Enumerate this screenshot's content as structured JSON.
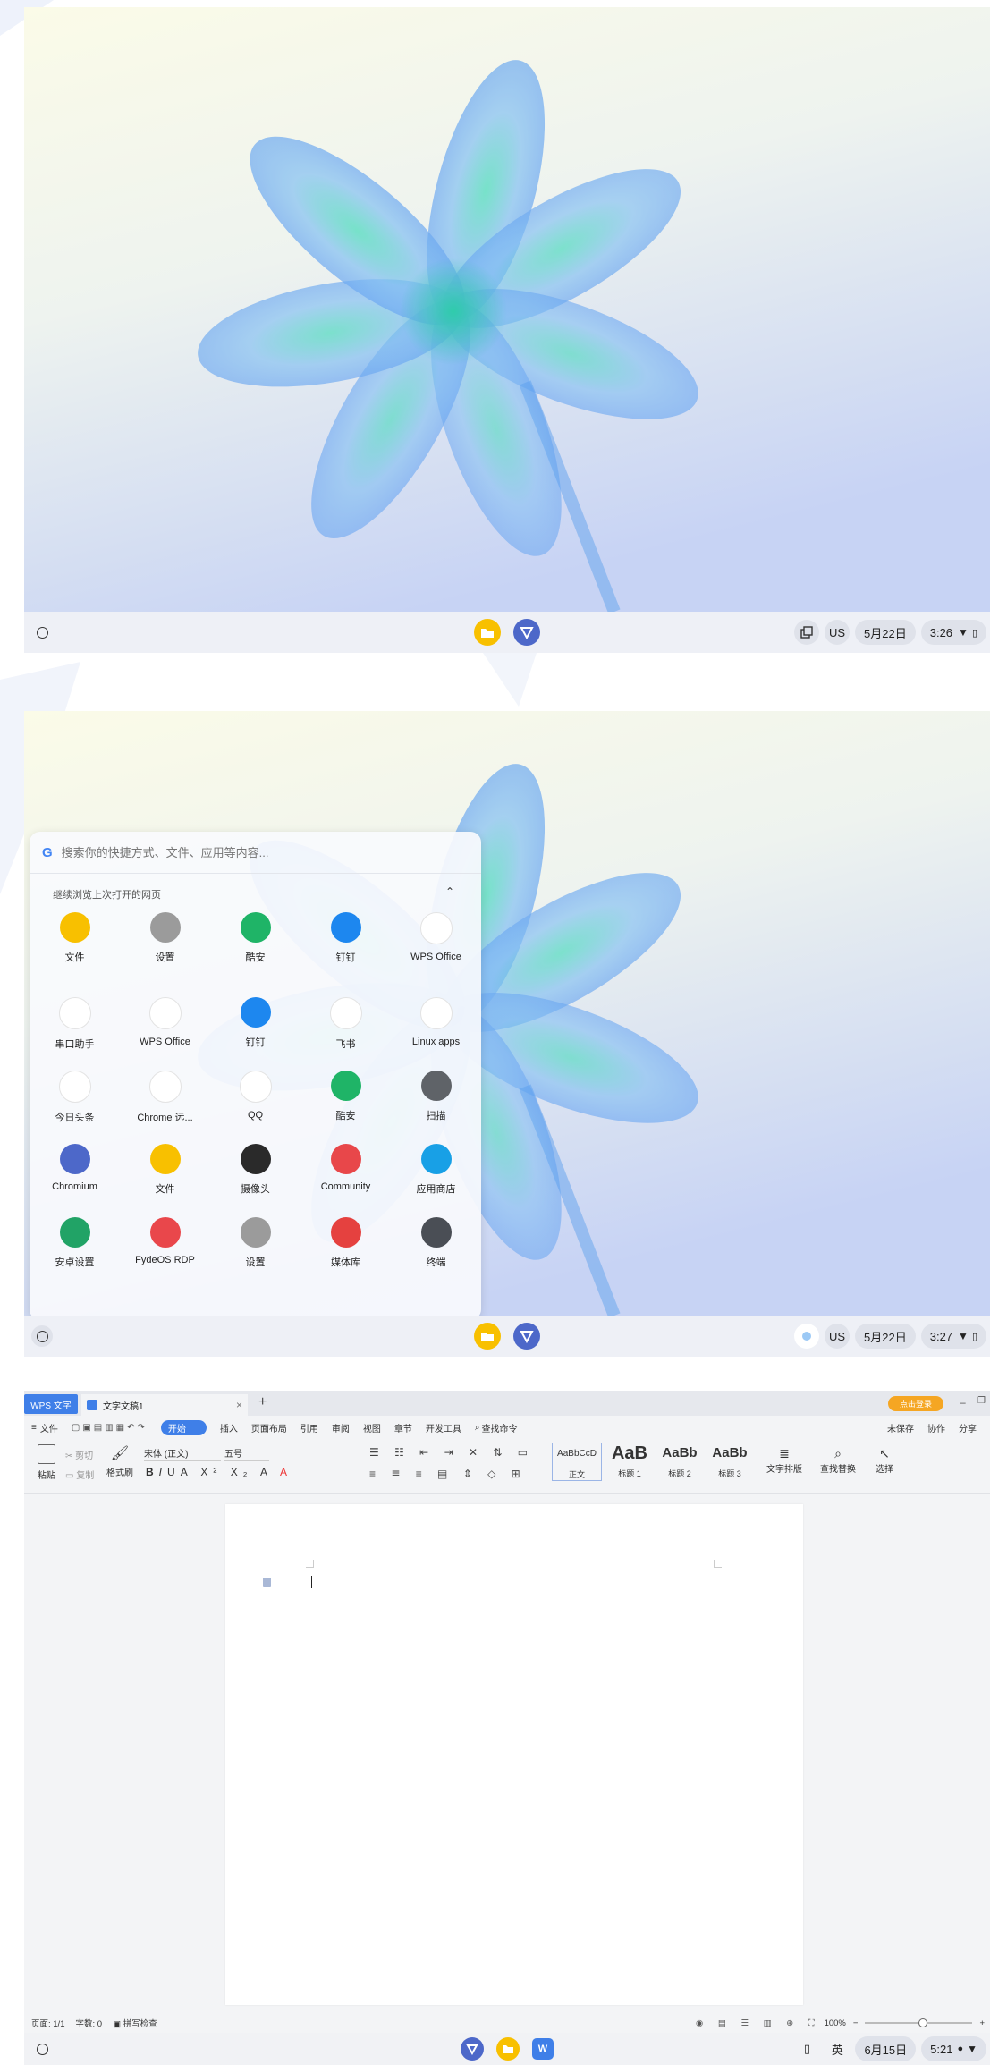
{
  "screens": [
    {
      "shelf": {
        "tray": {
          "ime": "US",
          "date": "5月22日",
          "time": "3:26"
        }
      }
    },
    {
      "launcher": {
        "search_placeholder": "搜索你的快捷方式、文件、应用等内容...",
        "continue_label": "继续浏览上次打开的网页",
        "recent": [
          {
            "label": "文件",
            "icon": "files-icon",
            "color": "#f8c000"
          },
          {
            "label": "设置",
            "icon": "settings-icon",
            "color": "#9b9b9b"
          },
          {
            "label": "酷安",
            "icon": "coolapk-icon",
            "color": "#1fb467"
          },
          {
            "label": "钉钉",
            "icon": "dingtalk-icon",
            "color": "#1d87ef"
          },
          {
            "label": "WPS Office",
            "icon": "wps-office-icon",
            "color": "#ffffff"
          }
        ],
        "apps": [
          {
            "label": "串口助手",
            "icon": "serial-assistant-icon",
            "color": "#ffffff"
          },
          {
            "label": "WPS Office",
            "icon": "wps-office-icon",
            "color": "#ffffff"
          },
          {
            "label": "钉钉",
            "icon": "dingtalk-icon",
            "color": "#1d87ef"
          },
          {
            "label": "飞书",
            "icon": "feishu-icon",
            "color": "#ffffff"
          },
          {
            "label": "Linux apps",
            "icon": "linux-apps-icon",
            "color": "#ffffff"
          },
          {
            "label": "今日头条",
            "icon": "toutiao-icon",
            "color": "#ffffff"
          },
          {
            "label": "Chrome 远...",
            "icon": "chrome-remote-icon",
            "color": "#ffffff"
          },
          {
            "label": "QQ",
            "icon": "qq-icon",
            "color": "#ffffff"
          },
          {
            "label": "酷安",
            "icon": "coolapk-icon",
            "color": "#1fb467"
          },
          {
            "label": "扫描",
            "icon": "scan-icon",
            "color": "#5f6368"
          },
          {
            "label": "Chromium",
            "icon": "chromium-icon",
            "color": "#4d68c9"
          },
          {
            "label": "文件",
            "icon": "files-icon",
            "color": "#f8c000"
          },
          {
            "label": "摄像头",
            "icon": "camera-icon",
            "color": "#2a2a2a"
          },
          {
            "label": "Community",
            "icon": "community-icon",
            "color": "#e8474a"
          },
          {
            "label": "应用商店",
            "icon": "app-store-icon",
            "color": "#18a0e6"
          },
          {
            "label": "安卓设置",
            "icon": "android-settings-icon",
            "color": "#21a366"
          },
          {
            "label": "FydeOS RDP",
            "icon": "fydeos-rdp-icon",
            "color": "#e9474b"
          },
          {
            "label": "设置",
            "icon": "settings-icon",
            "color": "#9b9b9b"
          },
          {
            "label": "媒体库",
            "icon": "media-library-icon",
            "color": "#e5413f"
          },
          {
            "label": "终端",
            "icon": "terminal-icon",
            "color": "#4a4e55"
          }
        ]
      },
      "shelf": {
        "tray": {
          "ime": "US",
          "date": "5月22日",
          "time": "3:27"
        }
      }
    },
    {
      "wps": {
        "app_tab": "WPS 文字",
        "doc_tab": "文字文稿1",
        "login_label": "点击登录",
        "menu": {
          "file": "文件",
          "tabs": [
            "开始",
            "插入",
            "页面布局",
            "引用",
            "审阅",
            "视图",
            "章节",
            "开发工具"
          ],
          "search": "查找命令",
          "unsaved": "未保存",
          "collab": "协作",
          "share": "分享"
        },
        "ribbon": {
          "paste": "粘贴",
          "cut": "剪切",
          "copy": "复制",
          "format_painter": "格式刷",
          "font": "宋体 (正文)",
          "size": "五号",
          "styles": [
            {
              "preview": "AaBbCcD",
              "name": "正文"
            },
            {
              "preview": "AaB",
              "name": "标题 1"
            },
            {
              "preview": "AaBb",
              "name": "标题 2"
            },
            {
              "preview": "AaBb",
              "name": "标题 3"
            }
          ],
          "text_layout": "文字排版",
          "find_replace": "查找替换",
          "select": "选择"
        },
        "status": {
          "page": "页面: 1/1",
          "words": "字数: 0",
          "spell": "拼写检查",
          "zoom": "100%"
        }
      },
      "shelf": {
        "tray": {
          "ime": "英",
          "date": "6月15日",
          "time": "5:21"
        }
      }
    }
  ]
}
